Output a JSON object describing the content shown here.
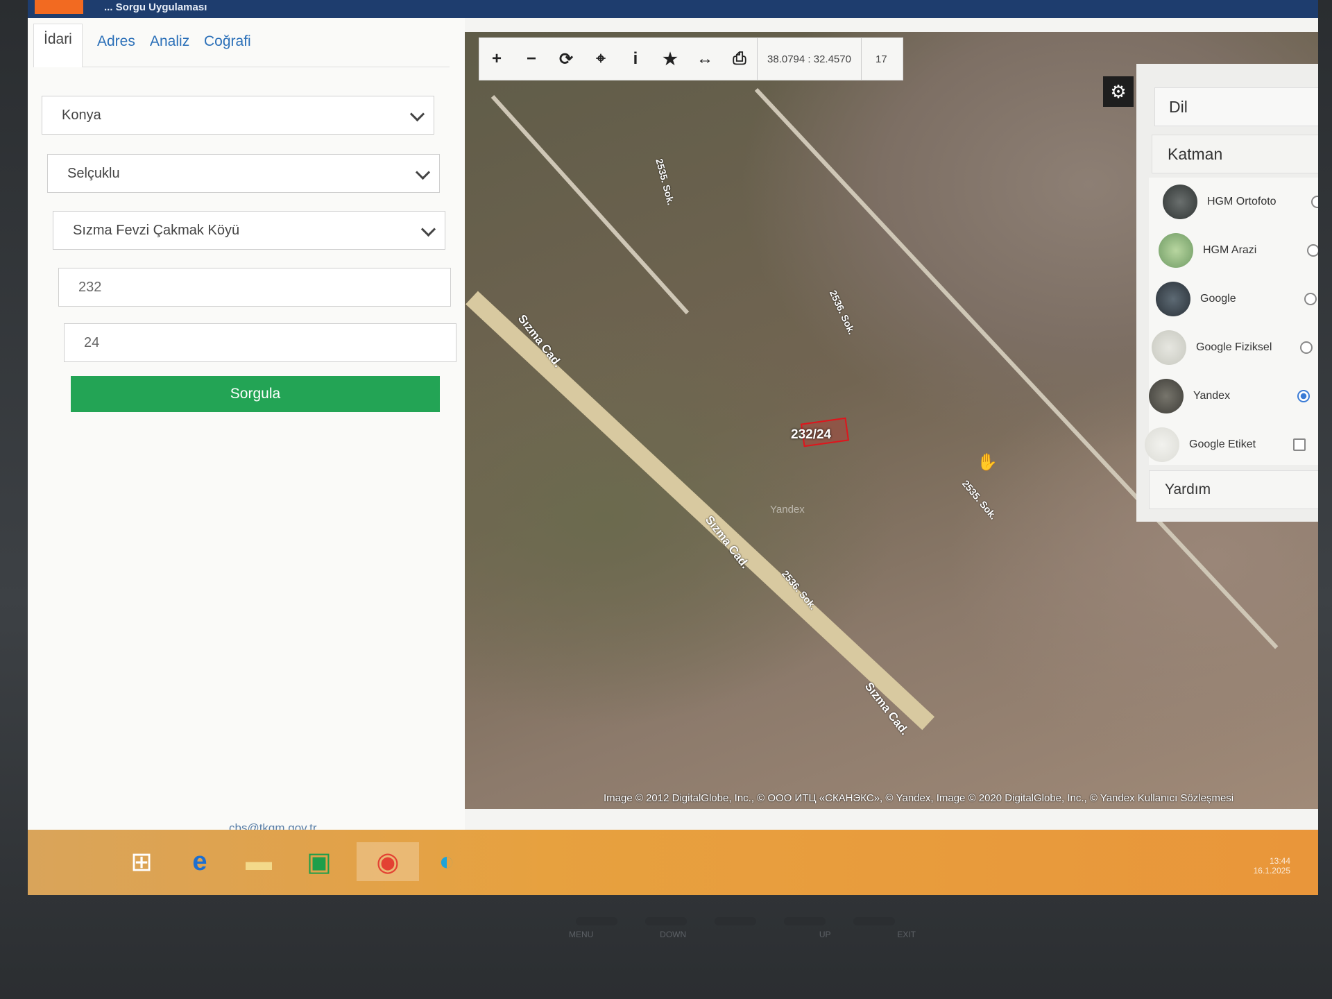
{
  "app": {
    "title": "... Sorgu Uygulaması"
  },
  "tabs": [
    {
      "label": "İdari",
      "active": true
    },
    {
      "label": "Adres"
    },
    {
      "label": "Analiz"
    },
    {
      "label": "Coğrafi"
    }
  ],
  "form": {
    "province": "Konya",
    "district": "Selçuklu",
    "neighborhood": "Sızma Fevzi Çakmak Köyü",
    "block": "232",
    "parcel": "24",
    "submit_label": "Sorgula"
  },
  "footer_email": "cbs@tkgm.gov.tr",
  "map": {
    "coords": "38.0794 : 32.4570",
    "zoom_level": "17",
    "parcel_label": "232/24",
    "road_labels": [
      "Sızma Cad.",
      "Sızma Cad.",
      "Sızma Cad.",
      "2535. Sok.",
      "2536. Sok.",
      "2535. Sok.",
      "2536. Sok."
    ],
    "copyright": "Image © 2012 DigitalGlobe, Inc., © ООО ИТЦ «СКАНЭКС», © Yandex, Image © 2020 DigitalGlobe, Inc., © Yandex Kullanıcı Sözleşmesi",
    "watermark": "Yandex"
  },
  "right_panel": {
    "dil_label": "Dil",
    "katman_label": "Katman",
    "yardim_label": "Yardım",
    "layers": [
      {
        "name": "HGM Ortofoto",
        "selected": false,
        "control": "radio"
      },
      {
        "name": "HGM Arazi",
        "selected": false,
        "control": "radio"
      },
      {
        "name": "Google",
        "selected": false,
        "control": "radio"
      },
      {
        "name": "Google Fiziksel",
        "selected": false,
        "control": "radio"
      },
      {
        "name": "Yandex",
        "selected": true,
        "control": "radio"
      },
      {
        "name": "Google Etiket",
        "selected": false,
        "control": "checkbox"
      }
    ]
  },
  "taskbar": {
    "clock_time": "13:44",
    "clock_date": "16.1.2025"
  },
  "monitor_buttons": [
    "MENU",
    "DOWN",
    "",
    "UP",
    "EXIT"
  ],
  "colors": {
    "accent_green": "#23a455",
    "link_blue": "#2a6fb8",
    "parcel_red": "#e0141c"
  }
}
